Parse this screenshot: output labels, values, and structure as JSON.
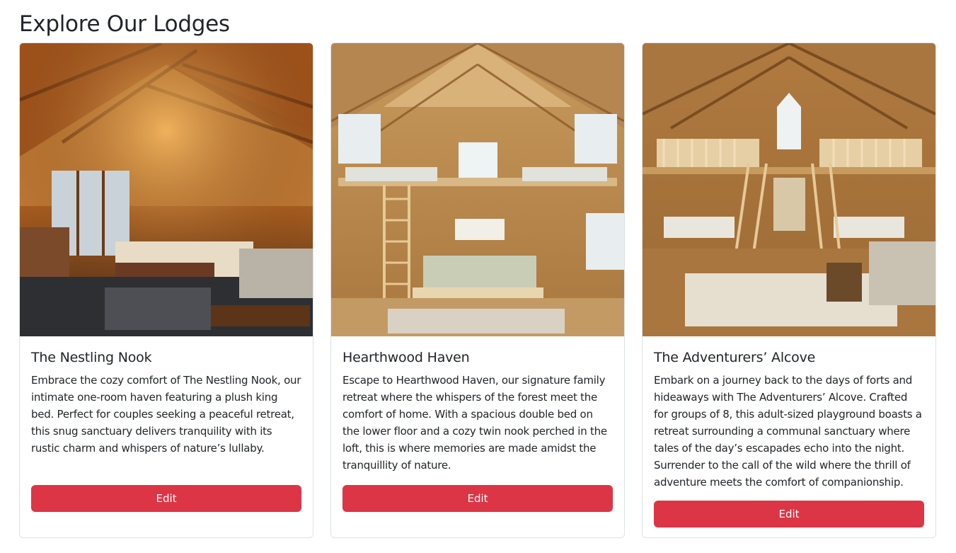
{
  "page": {
    "title": "Explore Our Lodges"
  },
  "lodges": [
    {
      "name": "The Nestling Nook",
      "description": "Embrace the cozy comfort of The Nestling Nook, our intimate one-room haven featuring a plush king bed. Perfect for couples seeking a peaceful retreat, this snug sanctuary delivers tranquility with its rustic charm and whispers of nature’s lullaby.",
      "button_label": "Edit"
    },
    {
      "name": "Hearthwood Haven",
      "description": "Escape to Hearthwood Haven, our signature family retreat where the whispers of the forest meet the comfort of home. With a spacious double bed on the lower floor and a cozy twin nook perched in the loft, this is where memories are made amidst the tranquillity of nature.",
      "button_label": "Edit"
    },
    {
      "name": "The Adventurers’ Alcove",
      "description": "Embark on a journey back to the days of forts and hideaways with The Adventurers’ Alcove. Crafted for groups of 8, this adult-sized playground boasts a retreat surrounding a communal sanctuary where tales of the day’s escapades echo into the night. Surrender to the call of the wild where the thrill of adventure meets the comfort of companionship.",
      "button_label": "Edit"
    }
  ],
  "colors": {
    "danger": "#dc3545",
    "border": "#dee2e6",
    "text": "#212529"
  }
}
